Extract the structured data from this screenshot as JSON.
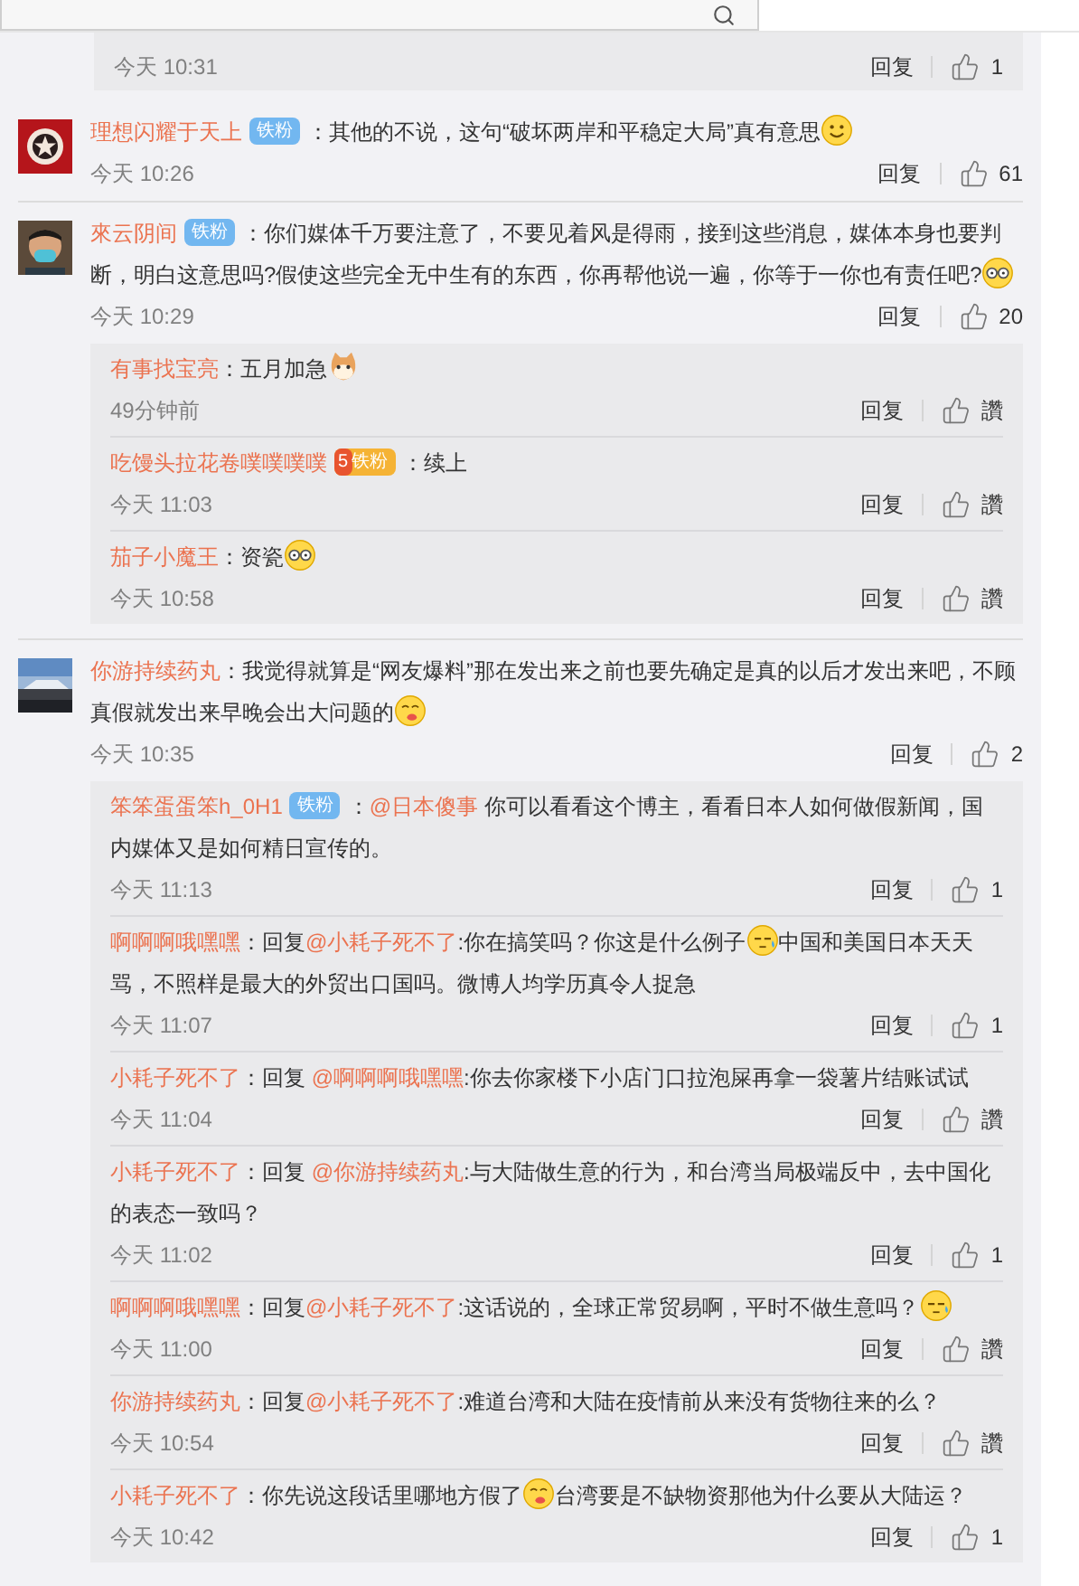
{
  "thread_tail": {
    "replies": [
      {
        "time": "今天 10:31",
        "reply": "回复",
        "likes": "1"
      }
    ]
  },
  "comments": [
    {
      "avatar": {
        "kind": "emblem"
      },
      "name": "理想闪耀于天上",
      "badge": {
        "kind": "fan",
        "label": "铁粉"
      },
      "content": [
        {
          "kind": "text",
          "text": "：其他的不说，这句“破坏两岸和平稳定大局”真有意思"
        },
        {
          "kind": "smile"
        }
      ],
      "time": "今天 10:26",
      "reply": "回复",
      "likes": "61"
    },
    {
      "avatar": {
        "kind": "person"
      },
      "name": "來云阴间",
      "badge": {
        "kind": "fan",
        "label": "铁粉"
      },
      "content": [
        {
          "kind": "text",
          "text": "：你们媒体千万要注意了，不要见着风是得雨，接到这些消息，媒体本身也要判断，明白这意思吗?假使这些完全无中生有的东西，你再帮他说一遍，你等于一你也有责任吧?"
        },
        {
          "kind": "glasses"
        }
      ],
      "time": "今天 10:29",
      "reply": "回复",
      "likes": "20",
      "replies": [
        {
          "name": "有事找宝亮",
          "content": [
            {
              "kind": "text",
              "text": "：五月加急"
            },
            {
              "kind": "cat"
            }
          ],
          "time": "49分钟前",
          "reply": "回复",
          "likes": "讚"
        },
        {
          "name": "吃馒头拉花卷噗噗噗噗",
          "badge": {
            "kind": "gold",
            "level": "5",
            "label": "铁粉"
          },
          "content": [
            {
              "kind": "text",
              "text": "：续上"
            }
          ],
          "time": "今天 11:03",
          "reply": "回复",
          "likes": "讚"
        },
        {
          "name": "茄子小魔王",
          "content": [
            {
              "kind": "text",
              "text": "：资瓷"
            },
            {
              "kind": "glasses"
            }
          ],
          "time": "今天 10:58",
          "reply": "回复",
          "likes": "讚"
        }
      ]
    },
    {
      "avatar": {
        "kind": "picture"
      },
      "name": "你游持续药丸",
      "content": [
        {
          "kind": "text",
          "text": "：我觉得就算是“网友爆料”那在发出来之前也要先确定是真的以后才发出来吧，不顾真假就发出来早晚会出大问题的"
        },
        {
          "kind": "drool"
        }
      ],
      "time": "今天 10:35",
      "reply": "回复",
      "likes": "2",
      "replies": [
        {
          "name": "笨笨蛋蛋笨h_0H1",
          "badge": {
            "kind": "fan",
            "label": "铁粉"
          },
          "content": [
            {
              "kind": "text",
              "text": "："
            },
            {
              "kind": "mention",
              "text": "@日本傻事"
            },
            {
              "kind": "text",
              "text": " 你可以看看这个博主，看看日本人如何做假新闻，国内媒体又是如何精日宣传的。"
            }
          ],
          "time": "今天 11:13",
          "reply": "回复",
          "likes": "1"
        },
        {
          "name": "啊啊啊哦嘿嘿",
          "content": [
            {
              "kind": "text",
              "text": "：回复"
            },
            {
              "kind": "mention",
              "text": "@小耗子死不了"
            },
            {
              "kind": "text",
              "text": ":你在搞笑吗？你这是什么例子"
            },
            {
              "kind": "sweat"
            },
            {
              "kind": "text",
              "text": "中国和美国日本天天骂，不照样是最大的外贸出口国吗。微博人均学历真令人捉急"
            }
          ],
          "time": "今天 11:07",
          "reply": "回复",
          "likes": "1"
        },
        {
          "name": "小耗子死不了",
          "content": [
            {
              "kind": "text",
              "text": "：回复 "
            },
            {
              "kind": "mention",
              "text": "@啊啊啊哦嘿嘿"
            },
            {
              "kind": "text",
              "text": ":你去你家楼下小店门口拉泡屎再拿一袋薯片结账试试"
            }
          ],
          "time": "今天 11:04",
          "reply": "回复",
          "likes": "讚"
        },
        {
          "name": "小耗子死不了",
          "content": [
            {
              "kind": "text",
              "text": "：回复 "
            },
            {
              "kind": "mention",
              "text": "@你游持续药丸"
            },
            {
              "kind": "text",
              "text": ":与大陆做生意的行为，和台湾当局极端反中，去中国化的表态一致吗？"
            }
          ],
          "time": "今天 11:02",
          "reply": "回复",
          "likes": "1"
        },
        {
          "name": "啊啊啊哦嘿嘿",
          "content": [
            {
              "kind": "text",
              "text": "：回复"
            },
            {
              "kind": "mention",
              "text": "@小耗子死不了"
            },
            {
              "kind": "text",
              "text": ":这话说的，全球正常贸易啊，平时不做生意吗？"
            },
            {
              "kind": "sweat"
            }
          ],
          "time": "今天 11:00",
          "reply": "回复",
          "likes": "讚"
        },
        {
          "name": "你游持续药丸",
          "content": [
            {
              "kind": "text",
              "text": "：回复"
            },
            {
              "kind": "mention",
              "text": "@小耗子死不了"
            },
            {
              "kind": "text",
              "text": ":难道台湾和大陆在疫情前从来没有货物往来的么？"
            }
          ],
          "time": "今天 10:54",
          "reply": "回复",
          "likes": "讚"
        },
        {
          "name": "小耗子死不了",
          "content": [
            {
              "kind": "text",
              "text": "：你先说这段话里哪地方假了"
            },
            {
              "kind": "drool"
            },
            {
              "kind": "text",
              "text": "台湾要是不缺物资那他为什么要从大陆运？"
            }
          ],
          "time": "今天 10:42",
          "reply": "回复",
          "likes": "1"
        }
      ]
    }
  ]
}
